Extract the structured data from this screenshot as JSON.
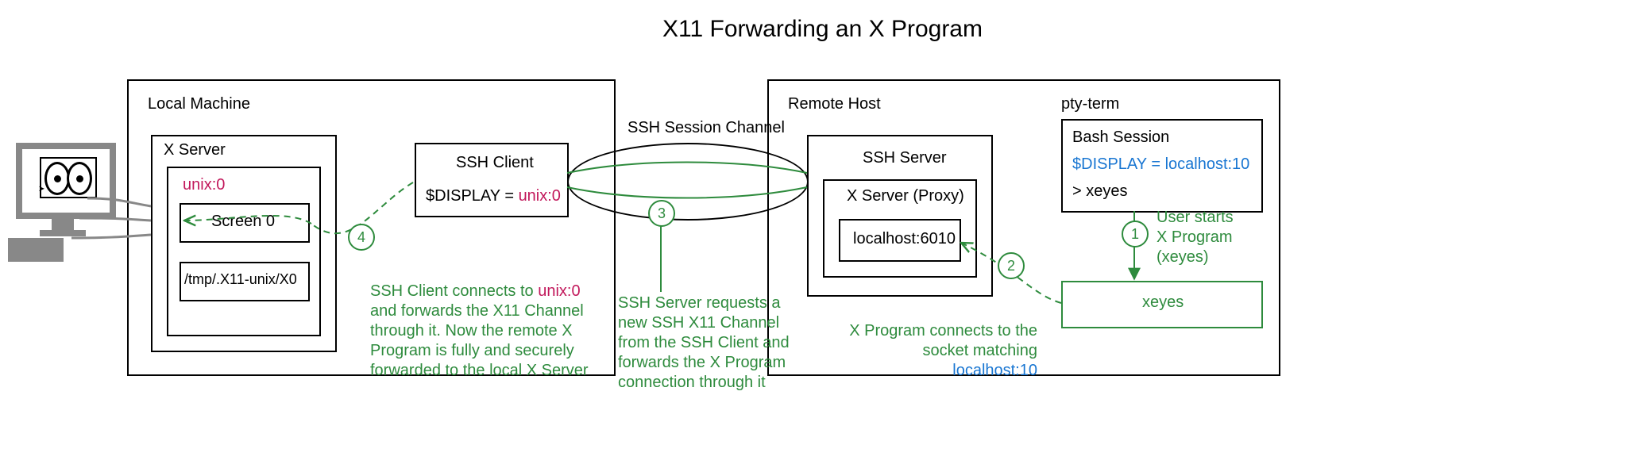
{
  "title": "X11 Forwarding an X Program",
  "local": {
    "title": "Local Machine",
    "xserver": {
      "title": "X Server",
      "unix": "unix:0",
      "screen": "Screen 0",
      "socket": "/tmp/.X11-unix/X0"
    },
    "ssh_client": {
      "title": "SSH Client",
      "display_label": "$DISPLAY = ",
      "display_value": "unix:0"
    }
  },
  "ssh_channel_label": "SSH Session Channel",
  "remote": {
    "title": "Remote Host",
    "ssh_server": {
      "title": "SSH Server",
      "proxy_title": "X Server (Proxy)",
      "socket": "localhost:6010"
    },
    "pty": {
      "title": "pty-term",
      "bash": "Bash Session",
      "display_label": "$DISPLAY = ",
      "display_value": "localhost:10",
      "prompt": "> xeyes"
    },
    "xeyes_box": "xeyes"
  },
  "steps": {
    "s1": {
      "num": "1",
      "text": "User starts\nX Program\n(xeyes)"
    },
    "s2": {
      "num": "2",
      "text_a": "X Program connects to the\nsocket matching ",
      "text_b": "localhost:10"
    },
    "s3": {
      "num": "3",
      "text": "SSH Server requests a\nnew SSH X11 Channel\nfrom the SSH Client and\nforwards the X Program\nconnection through it"
    },
    "s4": {
      "num": "4",
      "text_a": "SSH Client connects to ",
      "text_b": "unix:0",
      "text_c": "\nand forwards the X11 Channel\nthrough it. Now the remote X\nProgram is fully and securely\nforwarded to the local X Server"
    }
  }
}
